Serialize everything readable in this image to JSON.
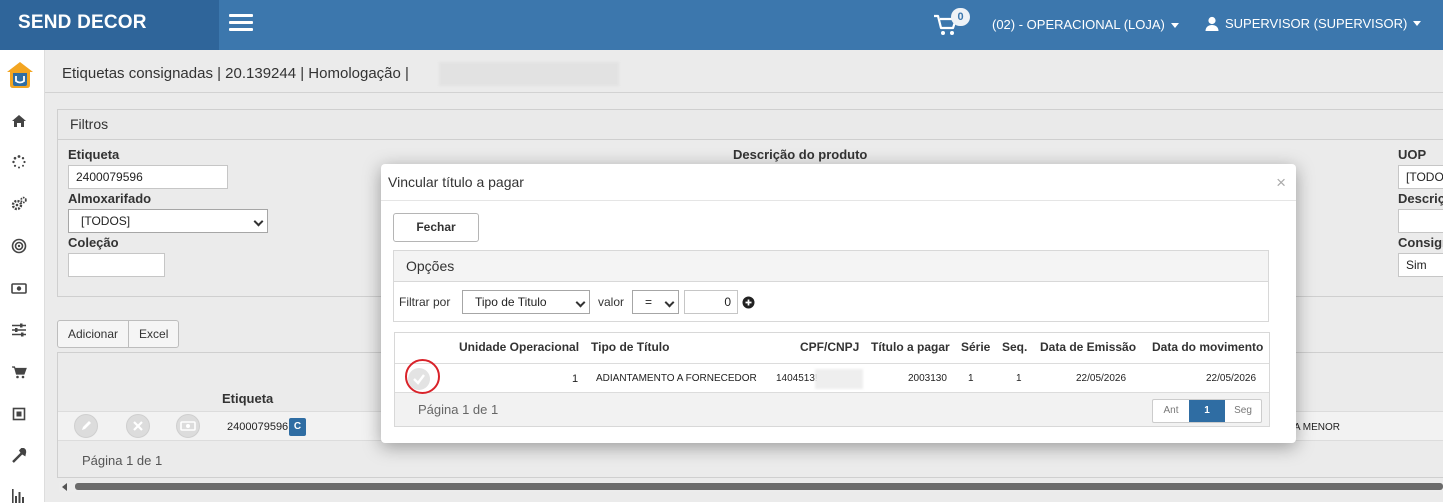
{
  "topbar": {
    "brand": "SEND DECOR",
    "cart_count": "0",
    "unit_menu": "(02) - OPERACIONAL (LOJA)",
    "user_menu": "SUPERVISOR (SUPERVISOR)"
  },
  "page": {
    "title": "Etiquetas consignadas | 20.139244 | Homologação |"
  },
  "filters": {
    "header": "Filtros",
    "etiqueta_label": "Etiqueta",
    "etiqueta_value": "2400079596",
    "almoxarifado_label": "Almoxarifado",
    "almoxarifado_value": "[TODOS]",
    "colecao_label": "Coleção",
    "descricao_produto_label": "Descrição do produto",
    "uop_label": "UOP",
    "uop_value": "[TODO",
    "descricao_label": "Descriç",
    "consig_label": "Consigr",
    "consig_value": "Sim"
  },
  "actions": {
    "adicionar": "Adicionar",
    "excel": "Excel"
  },
  "grid": {
    "etiqueta_header": "Etiqueta",
    "row_etiqueta": "2400079596",
    "row_badge": "C",
    "row_trailing": "ACA MENOR",
    "pagination": "Página 1 de 1"
  },
  "modal": {
    "title": "Vincular título a pagar",
    "close_glyph": "×",
    "fechar": "Fechar",
    "opcoes_header": "Opções",
    "filtrar_por_label": "Filtrar por",
    "filtrar_por_value": "Tipo de Titulo",
    "valor_label": "valor",
    "operator_value": "=",
    "value_input": "0",
    "columns": {
      "unidade": "Unidade Operacional",
      "tipo": "Tipo de Título",
      "cpf": "CPF/CNPJ",
      "titulo": "Título a pagar",
      "serie": "Série",
      "seq": "Seq.",
      "emissao": "Data de Emissão",
      "movimento": "Data do movimento"
    },
    "row": {
      "unidade": "1",
      "tipo": "ADIANTAMENTO A FORNECEDOR",
      "cpf": "1404513!",
      "titulo": "2003130",
      "serie": "1",
      "seq": "1",
      "emissao": "22/05/2026",
      "movimento": "22/05/2026"
    },
    "pagination_text": "Página 1 de 1",
    "pager": {
      "prev": "Ant",
      "current": "1",
      "next": "Seg"
    }
  },
  "colors": {
    "topbar": "#3c77ad",
    "brand_bg": "#2f659a",
    "primary_button": "#2f6da3",
    "highlight_ring": "#d9232a"
  }
}
